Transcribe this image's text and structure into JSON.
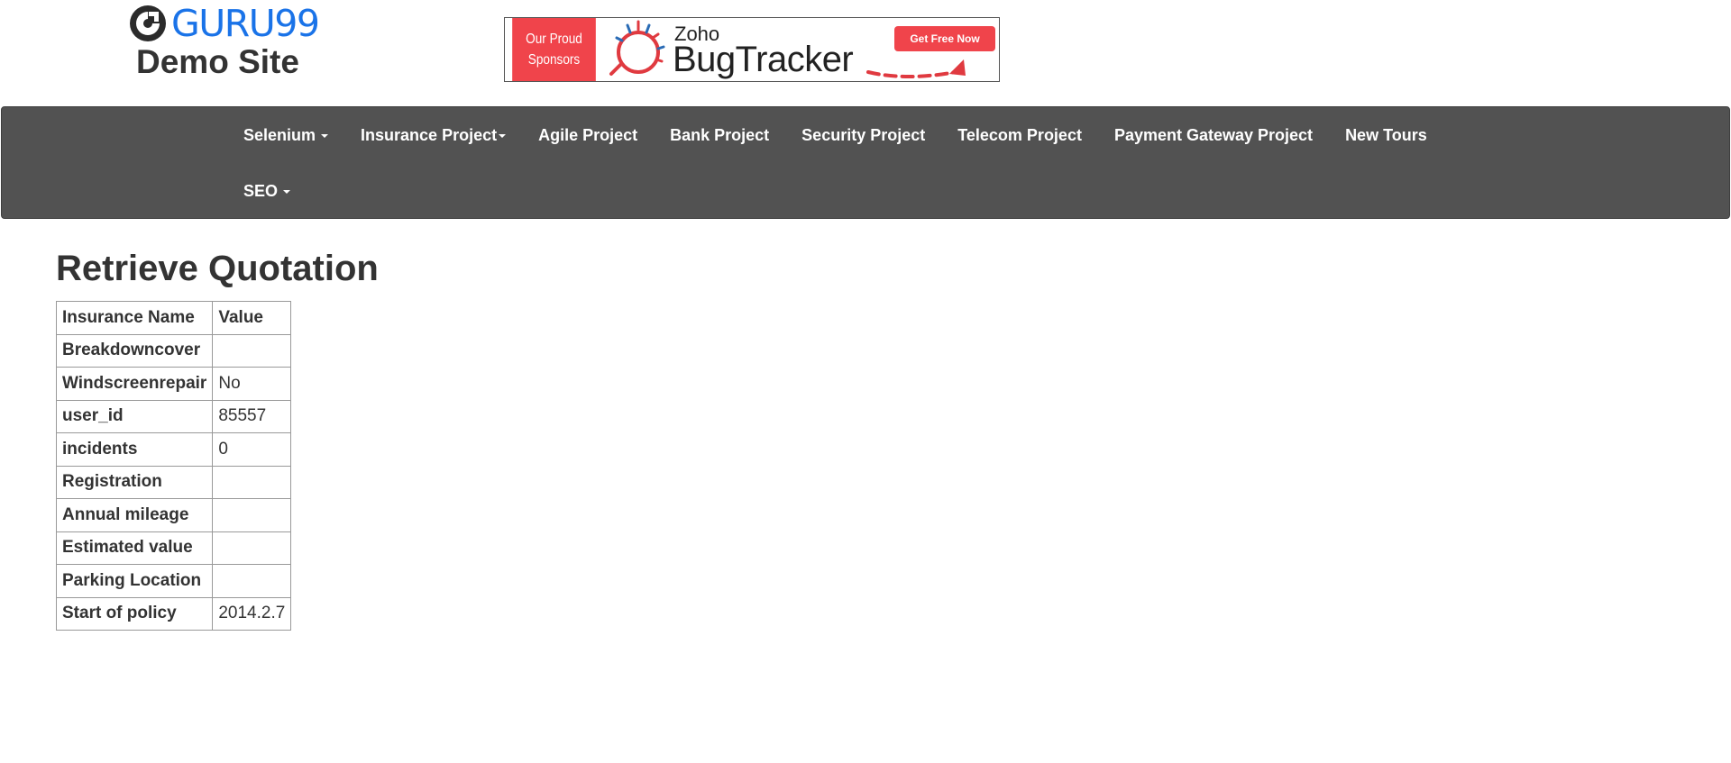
{
  "header": {
    "logo": {
      "brand": "GURU99",
      "subtitle": "Demo Site",
      "icon": "guru99-logo-icon"
    },
    "sponsor": {
      "label_line1": "Our Proud",
      "label_line2": "Sponsors",
      "product_prefix": "Zoho",
      "product_name": "BugTracker",
      "cta": "Get Free Now",
      "icon": "bug-icon",
      "accent_color": "#f0444b"
    }
  },
  "nav": {
    "background": "#525252",
    "items": [
      {
        "label": "Selenium",
        "dropdown": true
      },
      {
        "label": "Insurance Project",
        "dropdown": true
      },
      {
        "label": "Agile Project",
        "dropdown": false
      },
      {
        "label": "Bank Project",
        "dropdown": false
      },
      {
        "label": "Security Project",
        "dropdown": false
      },
      {
        "label": "Telecom Project",
        "dropdown": false
      },
      {
        "label": "Payment Gateway Project",
        "dropdown": false
      },
      {
        "label": "New Tours",
        "dropdown": false
      },
      {
        "label": "SEO",
        "dropdown": true
      }
    ]
  },
  "main": {
    "title": "Retrieve Quotation",
    "table": {
      "headers": [
        "Insurance Name",
        "Value"
      ],
      "rows": [
        {
          "name": "Breakdowncover",
          "value": ""
        },
        {
          "name": "Windscreenrepair",
          "value": "No"
        },
        {
          "name": "user_id",
          "value": "85557"
        },
        {
          "name": "incidents",
          "value": "0"
        },
        {
          "name": "Registration",
          "value": ""
        },
        {
          "name": "Annual mileage",
          "value": ""
        },
        {
          "name": "Estimated value",
          "value": ""
        },
        {
          "name": "Parking Location",
          "value": ""
        },
        {
          "name": "Start of policy",
          "value": "2014.2.7"
        }
      ]
    }
  }
}
